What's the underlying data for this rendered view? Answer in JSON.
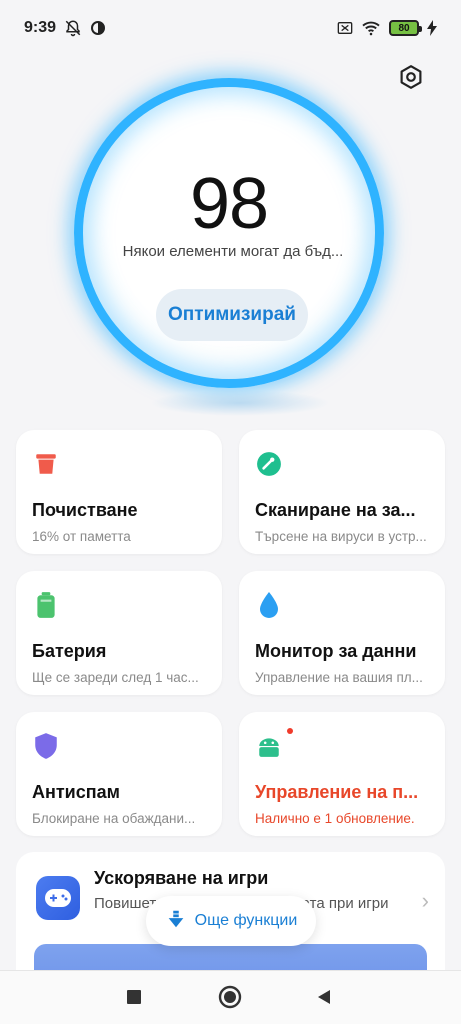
{
  "status_bar": {
    "time": "9:39",
    "icons_left": [
      "notifications-off-icon",
      "data-saver-icon"
    ],
    "icons_right": [
      "sim-off-icon",
      "wifi-icon",
      "battery-icon",
      "charging-icon"
    ],
    "battery_level": "80"
  },
  "header": {
    "settings_icon": "gear-icon"
  },
  "score": {
    "value": "98",
    "message": "Някои елементи могат да бъд...",
    "optimize_label": "Оптимизирай",
    "ring_color": "#2fb3ff"
  },
  "cards": [
    {
      "title": "Почистване",
      "subtitle": "16% от паметта",
      "icon": "trash-icon",
      "icon_color": "#f05b4b"
    },
    {
      "title": "Сканиране на за...",
      "subtitle": "Търсене на вируси в устр...",
      "icon": "scan-icon",
      "icon_color": "#1fbf8f"
    },
    {
      "title": "Батерия",
      "subtitle": "Ще се зареди след 1 час...",
      "icon": "battery-icon",
      "icon_color": "#4cc36e"
    },
    {
      "title": "Монитор за данни",
      "subtitle": "Управление на вашия пл...",
      "icon": "water-drop-icon",
      "icon_color": "#2b9ff2"
    },
    {
      "title": "Антиспам",
      "subtitle": "Блокиране на обаждани...",
      "icon": "shield-icon",
      "icon_color": "#7b6be8"
    },
    {
      "title": "Управление на п...",
      "subtitle": "Налично е 1 обновление.",
      "icon": "android-icon",
      "icon_color": "#2dbf8c"
    }
  ],
  "game_booster": {
    "title": "Ускоряване на игри",
    "description": "Повишете скоростта на връзката при игри",
    "icon": "gamepad-icon"
  },
  "more_functions": {
    "label": "Още функции",
    "icon": "arrow-down-icon"
  },
  "navbar": {
    "buttons": [
      "recents-icon",
      "home-icon",
      "back-icon"
    ]
  }
}
